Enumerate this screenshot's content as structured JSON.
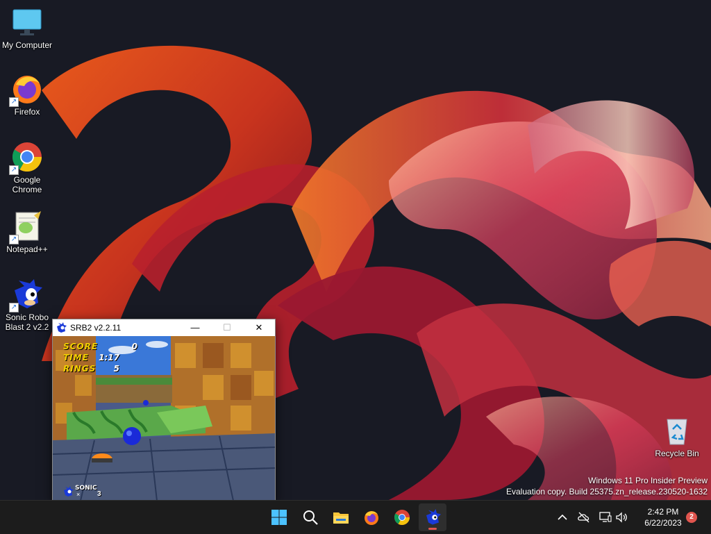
{
  "desktop": {
    "icons": [
      {
        "label": "My Computer",
        "icon": "monitor-icon"
      },
      {
        "label": "Firefox",
        "icon": "firefox-icon"
      },
      {
        "label": "Google Chrome",
        "icon": "chrome-icon"
      },
      {
        "label": "Notepad++",
        "icon": "notepadpp-icon"
      },
      {
        "label": "Sonic Robo Blast 2 v2.2",
        "icon": "sonic-icon"
      }
    ],
    "recycle_bin": {
      "label": "Recycle Bin",
      "icon": "recycle-bin-icon"
    },
    "watermark": {
      "line1": "Windows 11 Pro Insider Preview",
      "line2": "Evaluation copy. Build 25375.zn_release.230520-1632"
    }
  },
  "game_window": {
    "title": "SRB2 v2.2.11",
    "minimize": "—",
    "maximize": "☐",
    "close": "✕",
    "hud": {
      "score_label": "SCORE",
      "score_value": "0",
      "time_label": "TIME",
      "time_value": "1:17",
      "rings_label": "RINGS",
      "rings_value": "5",
      "lives_name": "SONIC",
      "lives_x": "×",
      "lives_count": "3"
    }
  },
  "taskbar": {
    "items": [
      {
        "name": "start",
        "icon": "windows-start-icon"
      },
      {
        "name": "search",
        "icon": "search-icon"
      },
      {
        "name": "file-explorer",
        "icon": "folder-icon"
      },
      {
        "name": "firefox",
        "icon": "firefox-icon"
      },
      {
        "name": "chrome",
        "icon": "chrome-icon"
      },
      {
        "name": "srb2",
        "icon": "sonic-icon",
        "active": true
      }
    ],
    "tray": {
      "chevron": "chevron-up-icon",
      "network": "cloud-off-icon",
      "display": "display-icon",
      "volume": "volume-icon"
    },
    "time": "2:42 PM",
    "date": "6/22/2023",
    "notification_count": "2"
  },
  "colors": {
    "accent_red": "#e0554e",
    "taskbar": "#1c1c1c",
    "hud_yellow": "#f4d000"
  }
}
